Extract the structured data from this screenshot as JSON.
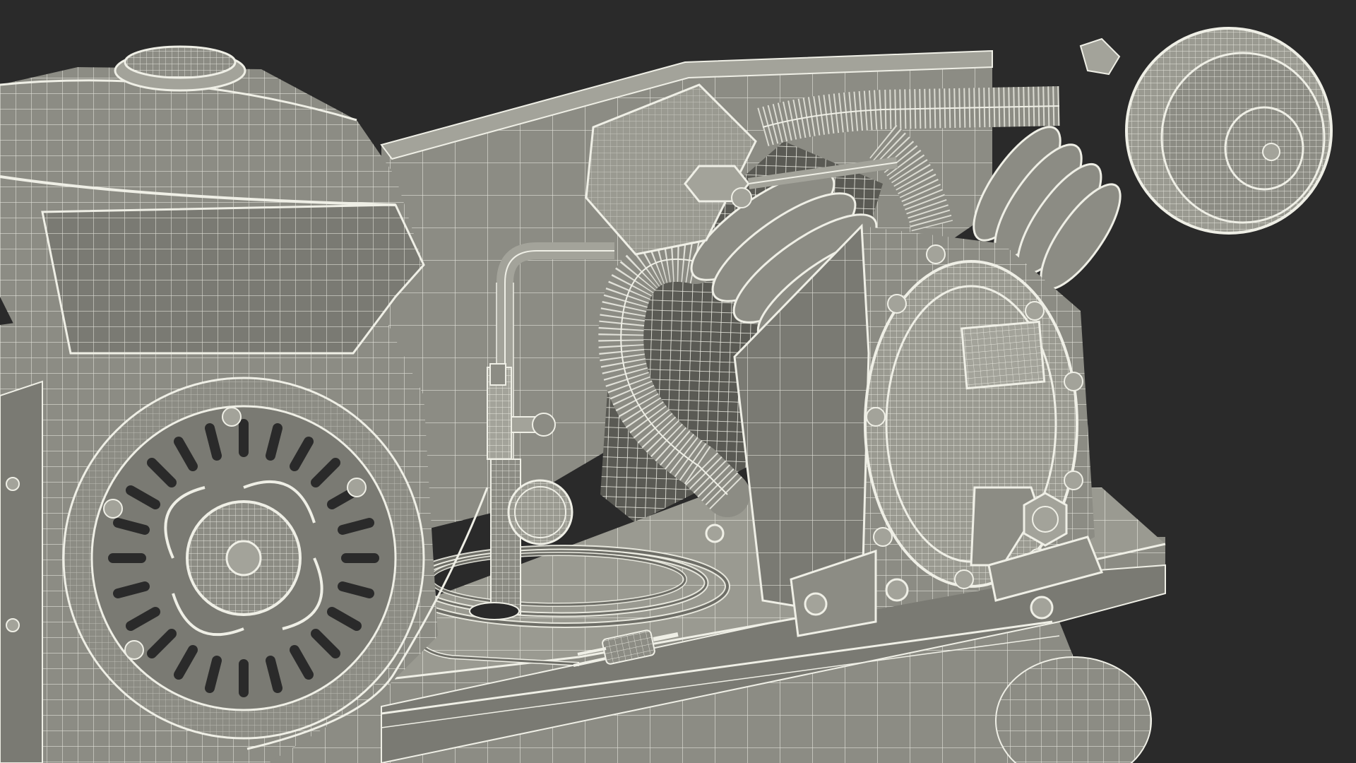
{
  "image": {
    "subject": "wireframe-render",
    "colors": {
      "background": "#2a2a2a",
      "surface": "#8c8c84",
      "surface_light": "#a3a39a",
      "surface_dark": "#6e6e67",
      "wire": "#efefe6",
      "wire_dense": "#dcdcd2",
      "shadow": "#4a4a45"
    }
  }
}
